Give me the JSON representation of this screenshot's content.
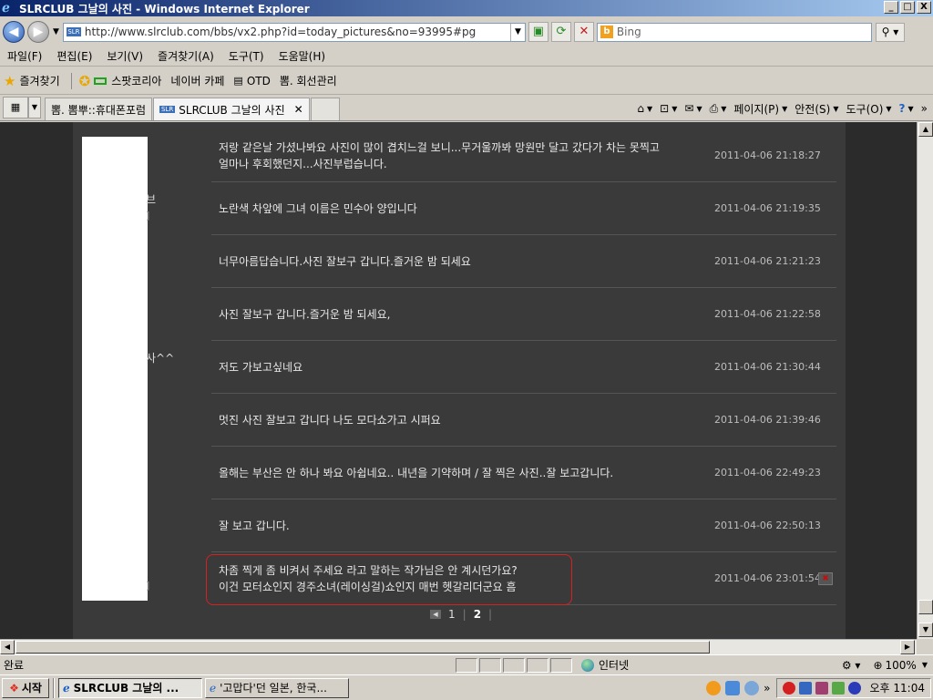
{
  "window": {
    "title": "SLRCLUB 그날의 사진 - Windows Internet Explorer",
    "minimize": "_",
    "maximize": "□",
    "close": "X"
  },
  "addressbar": {
    "url": "http://www.slrclub.com/bbs/vx2.php?id=today_pictures&no=93995#pg",
    "search_placeholder": "Bing"
  },
  "menu": [
    "파일(F)",
    "편집(E)",
    "보기(V)",
    "즐겨찾기(A)",
    "도구(T)",
    "도움말(H)"
  ],
  "favorites": {
    "label": "즐겨찾기",
    "items": [
      "스팟코리아",
      "네이버 카페",
      "OTD",
      "뽐. 회선관리"
    ]
  },
  "tabs": [
    {
      "label": "뽐. 뽐뿌::휴대폰포럼",
      "active": false
    },
    {
      "label": "SLRCLUB 그날의 사진",
      "active": true
    }
  ],
  "tools": {
    "page": "페이지(P)",
    "safety": "안전(S)",
    "tools": "도구(O)",
    "more": "»"
  },
  "comments": [
    {
      "lines": [
        "저랑 같은날 가셨나봐요 사진이 많이 겹치느걸 보니...무거울까봐 망원만 달고 갔다가 차는 못찍고",
        "얼마나 후회했던지...사진부럽습니다."
      ],
      "date": "2011-04-06 21:18:27"
    },
    {
      "lines": [
        "노란색 차앞에 그녀 이름은 민수아 양입니다"
      ],
      "date": "2011-04-06 21:19:35"
    },
    {
      "lines": [
        "너무아름답습니다.사진 잘보구 갑니다.즐거운 밤 되세요"
      ],
      "date": "2011-04-06 21:21:23"
    },
    {
      "lines": [
        "사진 잘보구 갑니다.즐거운 밤 되세요,"
      ],
      "date": "2011-04-06 21:22:58"
    },
    {
      "lines": [
        "저도 가보고싶네요"
      ],
      "date": "2011-04-06 21:30:44"
    },
    {
      "lines": [
        "멋진 사진 잘보고 갑니다 나도 모다쇼가고 시퍼요"
      ],
      "date": "2011-04-06 21:39:46"
    },
    {
      "lines": [
        "올해는 부산은 안 하나 봐요 아쉽네요.. 내년을 기약하며 / 잘 찍은 사진..잘 보고갑니다."
      ],
      "date": "2011-04-06 22:49:23"
    },
    {
      "lines": [
        "잘 보고 갑니다."
      ],
      "date": "2011-04-06 22:50:13"
    },
    {
      "lines": [
        "차좀 찍게 좀 비켜서 주세요 라고 말하는 작가님은 안 계시던가요?",
        "이건 모터쇼인지 경주소녀(레이싱걸)쇼인지 매번 헷갈리더군요 흠"
      ],
      "date": "2011-04-06 23:01:54"
    }
  ],
  "nick_fragments": [
    "브",
    "]",
    "사^^",
    "]"
  ],
  "pager": {
    "prev": "◀",
    "pages": [
      "1",
      "2"
    ]
  },
  "status": {
    "text": "완료",
    "zone": "인터넷",
    "zoom": "100%"
  },
  "taskbar": {
    "start": "시작",
    "buttons": [
      "SLRCLUB 그날의 ...",
      "'고맙다'던 일본, 한국..."
    ],
    "clock": "오후 11:04"
  }
}
